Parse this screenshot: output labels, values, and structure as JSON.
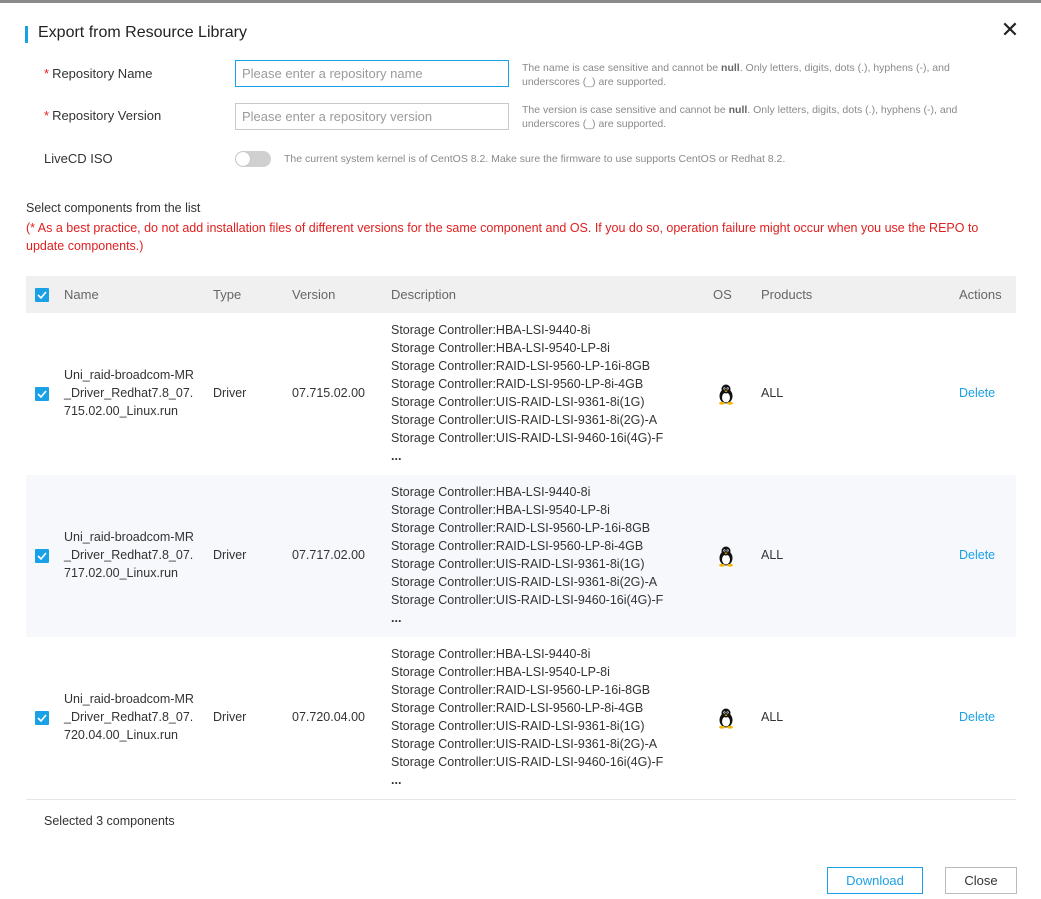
{
  "dialog": {
    "title": "Export from Resource Library",
    "close_icon": "close-icon"
  },
  "form": {
    "repo_name": {
      "required_mark": "*",
      "label": "Repository Name",
      "value": "",
      "placeholder": "Please enter a repository name",
      "hint_pre": "The name is case sensitive and cannot be ",
      "hint_bold": "null",
      "hint_post": ". Only letters, digits, dots (.), hyphens (-), and underscores (_) are supported."
    },
    "repo_version": {
      "required_mark": "*",
      "label": "Repository Version",
      "value": "",
      "placeholder": "Please enter a repository version",
      "hint_pre": "The version is case sensitive and cannot be ",
      "hint_bold": "null",
      "hint_post": ". Only letters, digits, dots (.), hyphens (-), and underscores (_) are supported."
    },
    "livecd": {
      "label": "LiveCD ISO",
      "enabled": false,
      "hint": "The current system kernel is of CentOS 8.2. Make sure the firmware to use supports CentOS or Redhat 8.2."
    }
  },
  "components": {
    "title": "Select components from the list",
    "warning": "(* As a best practice, do not add installation files of different versions for the same component and OS. If you do so, operation failure might occur when you use the REPO to update components.)",
    "columns": {
      "name": "Name",
      "type": "Type",
      "version": "Version",
      "description": "Description",
      "os": "OS",
      "products": "Products",
      "actions": "Actions"
    },
    "rows": [
      {
        "checked": true,
        "name": "Uni_raid-broadcom-MR_Driver_Redhat7.8_07.715.02.00_Linux.run",
        "type": "Driver",
        "version": "07.715.02.00",
        "description": [
          "Storage Controller:HBA-LSI-9440-8i",
          "Storage Controller:HBA-LSI-9540-LP-8i",
          "Storage Controller:RAID-LSI-9560-LP-16i-8GB",
          "Storage Controller:RAID-LSI-9560-LP-8i-4GB",
          "Storage Controller:UIS-RAID-LSI-9361-8i(1G)",
          "Storage Controller:UIS-RAID-LSI-9361-8i(2G)-A",
          "Storage Controller:UIS-RAID-LSI-9460-16i(4G)-F",
          "..."
        ],
        "os_icon": "linux-penguin-icon",
        "products": "ALL",
        "action": "Delete"
      },
      {
        "checked": true,
        "name": "Uni_raid-broadcom-MR_Driver_Redhat7.8_07.717.02.00_Linux.run",
        "type": "Driver",
        "version": "07.717.02.00",
        "description": [
          "Storage Controller:HBA-LSI-9440-8i",
          "Storage Controller:HBA-LSI-9540-LP-8i",
          "Storage Controller:RAID-LSI-9560-LP-16i-8GB",
          "Storage Controller:RAID-LSI-9560-LP-8i-4GB",
          "Storage Controller:UIS-RAID-LSI-9361-8i(1G)",
          "Storage Controller:UIS-RAID-LSI-9361-8i(2G)-A",
          "Storage Controller:UIS-RAID-LSI-9460-16i(4G)-F",
          "..."
        ],
        "os_icon": "linux-penguin-icon",
        "products": "ALL",
        "action": "Delete"
      },
      {
        "checked": true,
        "name": "Uni_raid-broadcom-MR_Driver_Redhat7.8_07.720.04.00_Linux.run",
        "type": "Driver",
        "version": "07.720.04.00",
        "description": [
          "Storage Controller:HBA-LSI-9440-8i",
          "Storage Controller:HBA-LSI-9540-LP-8i",
          "Storage Controller:RAID-LSI-9560-LP-16i-8GB",
          "Storage Controller:RAID-LSI-9560-LP-8i-4GB",
          "Storage Controller:UIS-RAID-LSI-9361-8i(1G)",
          "Storage Controller:UIS-RAID-LSI-9361-8i(2G)-A",
          "Storage Controller:UIS-RAID-LSI-9460-16i(4G)-F",
          "..."
        ],
        "os_icon": "linux-penguin-icon",
        "products": "ALL",
        "action": "Delete"
      }
    ],
    "selected_summary": "Selected 3 components"
  },
  "footer": {
    "download_label": "Download",
    "close_label": "Close"
  },
  "colors": {
    "accent": "#1aa0e6",
    "required": "#e02020",
    "warning": "#e02020"
  }
}
